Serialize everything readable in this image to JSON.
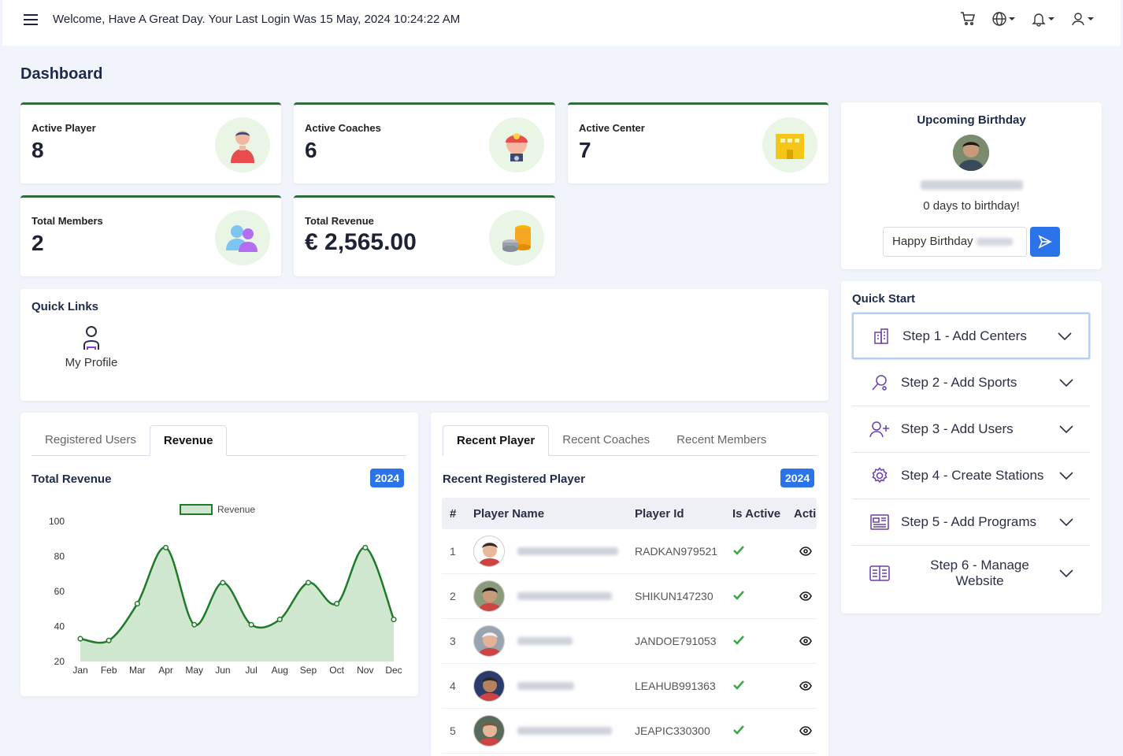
{
  "header": {
    "welcome": "Welcome, Have A Great Day. Your Last Login Was 15 May, 2024 10:24:22 AM"
  },
  "page_title": "Dashboard",
  "stats": [
    {
      "label": "Active Player",
      "value": "8"
    },
    {
      "label": "Active Coaches",
      "value": "6"
    },
    {
      "label": "Active Center",
      "value": "7"
    },
    {
      "label": "Total Members",
      "value": "2"
    },
    {
      "label": "Total Revenue",
      "value": "€ 2,565.00"
    }
  ],
  "birthday": {
    "title": "Upcoming Birthday",
    "name": "Shintaro KUNEDA",
    "days": "0 days to birthday!",
    "message_prefix": "Happy Birthday"
  },
  "quick_links": {
    "title": "Quick Links",
    "items": [
      {
        "label": "My Profile",
        "icon": "user-icon"
      }
    ]
  },
  "quick_start": {
    "title": "Quick Start",
    "steps": [
      {
        "label": "Step 1 - Add Centers",
        "icon": "building-icon"
      },
      {
        "label": "Step 2 - Add Sports",
        "icon": "racket-icon"
      },
      {
        "label": "Step 3 - Add Users",
        "icon": "user-plus-icon"
      },
      {
        "label": "Step 4 - Create Stations",
        "icon": "gear-icon"
      },
      {
        "label": "Step 5 - Add Programs",
        "icon": "newspaper-icon"
      },
      {
        "label": "Step 6 - Manage Website",
        "icon": "website-icon"
      }
    ]
  },
  "revenue_panel": {
    "tabs": [
      "Registered Users",
      "Revenue"
    ],
    "active_tab": "Revenue",
    "title": "Total Revenue",
    "year": "2024"
  },
  "chart_data": {
    "type": "area",
    "categories": [
      "Jan",
      "Feb",
      "Mar",
      "Apr",
      "May",
      "Jun",
      "Jul",
      "Aug",
      "Sep",
      "Oct",
      "Nov",
      "Dec"
    ],
    "series": [
      {
        "name": "Revenue",
        "values": [
          33,
          32,
          53,
          85,
          41,
          65,
          41,
          44,
          65,
          53,
          85,
          44
        ]
      }
    ],
    "ylim": [
      20,
      100
    ],
    "yticks": [
      "20",
      "40",
      "60",
      "80",
      "100"
    ],
    "legend": "top-center",
    "colors": {
      "line": "#1f7a2a",
      "fill": "#cfe6cf"
    }
  },
  "players_panel": {
    "tabs": [
      "Recent Player",
      "Recent Coaches",
      "Recent Members"
    ],
    "active_tab": "Recent Player",
    "title": "Recent Registered Player",
    "year": "2024",
    "columns": [
      "#",
      "Player Name",
      "Player Id",
      "Is Active",
      "Actions"
    ],
    "rows": [
      {
        "num": "1",
        "name": "Radhika KANITKAR",
        "id": "RADKAN979521"
      },
      {
        "num": "2",
        "name": "Shintaro KUNEDA",
        "id": "SHIKUN147230"
      },
      {
        "num": "3",
        "name": "Jane DOE",
        "id": "JANDOE791053"
      },
      {
        "num": "4",
        "name": "Lea HUBER",
        "id": "LEAHUB991363"
      },
      {
        "num": "5",
        "name": "Jean Luc PICARD",
        "id": "JEAPIC330300"
      }
    ]
  }
}
